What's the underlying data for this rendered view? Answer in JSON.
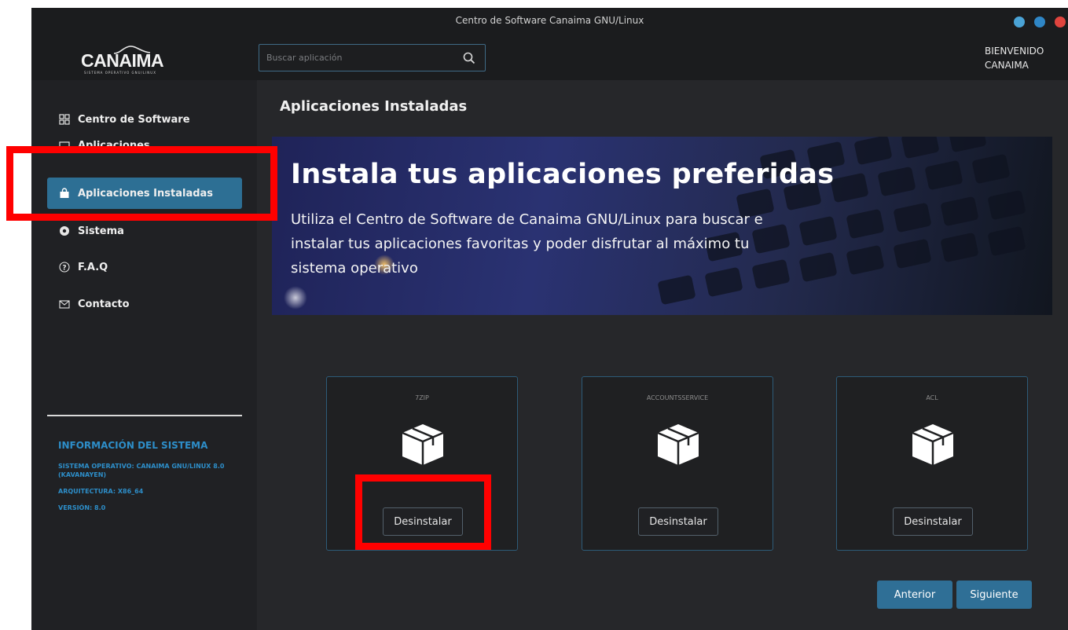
{
  "window": {
    "title": "Centro de Software Canaima GNU/Linux"
  },
  "header": {
    "logo_text": "CANAIMA",
    "logo_subtext": "SISTEMA OPERATIVO GNU/LINUX",
    "search_placeholder": "Buscar aplicación",
    "welcome_line1": "BIENVENIDO",
    "welcome_line2": "CANAIMA"
  },
  "sidebar": {
    "items": [
      {
        "label": "Centro de Software",
        "icon": "grid-icon"
      },
      {
        "label": "Aplicaciones",
        "icon": "window-icon"
      },
      {
        "label": "Aplicaciones Instaladas",
        "icon": "bag-icon",
        "active": true
      },
      {
        "label": "Sistema",
        "icon": "system-icon"
      },
      {
        "label": "F.A.Q",
        "icon": "question-icon"
      },
      {
        "label": "Contacto",
        "icon": "mail-icon"
      }
    ],
    "system_info": {
      "heading": "INFORMACIÓN DEL SISTEMA",
      "os": "SISTEMA OPERATIVO: CANAIMA GNU/LINUX 8.0 (KAVANAYEN)",
      "arch": "ARQUITECTURA: X86_64",
      "version": "VERSIÓN: 8.0"
    }
  },
  "main": {
    "title": "Aplicaciones Instaladas",
    "banner": {
      "heading": "Instala tus aplicaciones preferidas",
      "text": "Utiliza el Centro de Software de Canaima GNU/Linux para buscar e instalar tus aplicaciones favoritas y poder disfrutar al máximo tu sistema operativo"
    },
    "apps": [
      {
        "name": "7ZIP",
        "action": "Desinstalar"
      },
      {
        "name": "ACCOUNTSSERVICE",
        "action": "Desinstalar"
      },
      {
        "name": "ACL",
        "action": "Desinstalar"
      }
    ],
    "pagination": {
      "prev": "Anterior",
      "next": "Siguiente"
    }
  },
  "colors": {
    "accent": "#2d6f94",
    "info_text": "#2d8ec9",
    "highlight": "#ff0000"
  }
}
